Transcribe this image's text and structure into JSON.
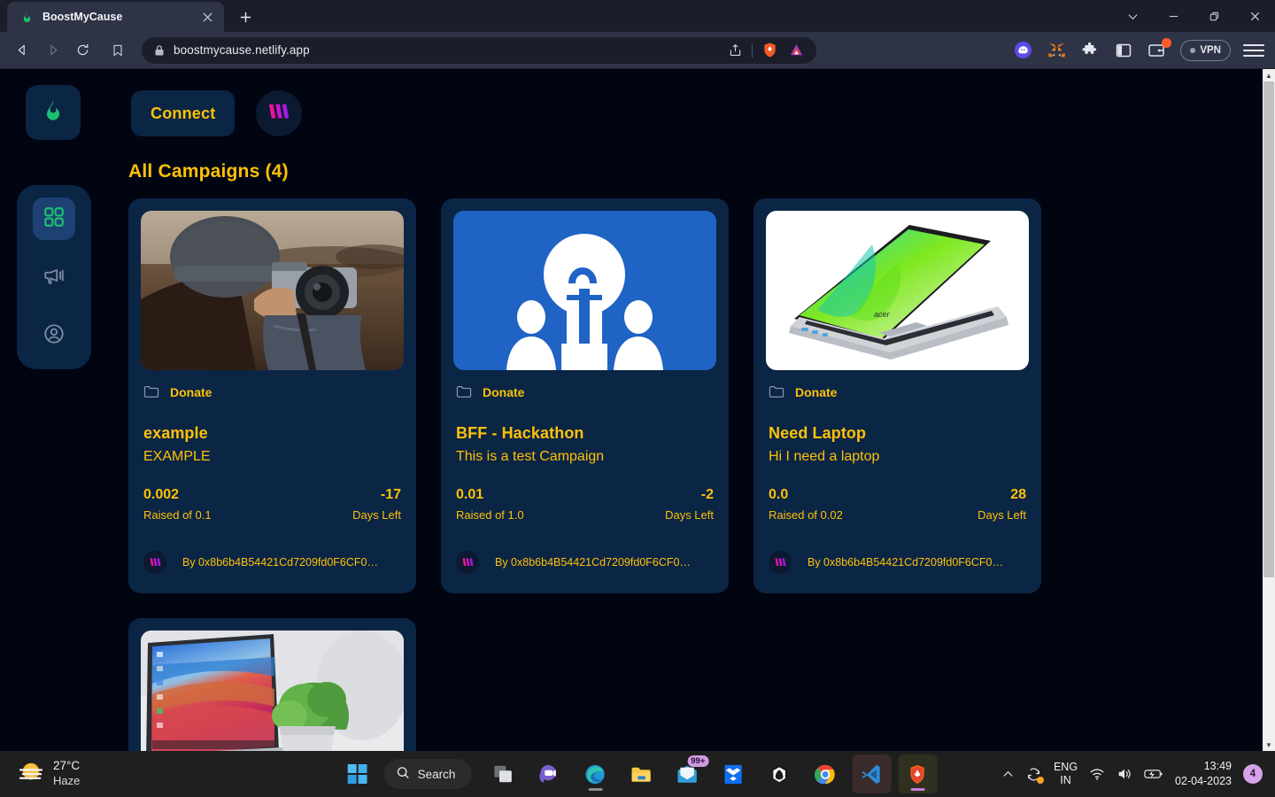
{
  "browser": {
    "tab": {
      "title": "BoostMyCause",
      "favicon_icon": "flame-favicon",
      "close_icon": "close-icon"
    },
    "new_tab_icon": "plus-icon",
    "window_controls": [
      {
        "name": "tab-search-button",
        "icon": "chevron-down-icon"
      },
      {
        "name": "minimize-button",
        "icon": "minimize-icon"
      },
      {
        "name": "restore-button",
        "icon": "restore-icon"
      },
      {
        "name": "close-window-button",
        "icon": "close-icon"
      }
    ],
    "nav": {
      "back_icon": "back-arrow-icon",
      "forward_icon": "forward-arrow-icon",
      "reload_icon": "reload-icon",
      "bookmark_icon": "bookmark-icon"
    },
    "omnibox": {
      "url": "boostmycause.netlify.app",
      "lock_icon": "lock-icon",
      "share_icon": "share-icon",
      "shields_icon": "brave-shields-icon",
      "rewards_icon": "brave-rewards-icon"
    },
    "extensions": [
      {
        "name": "phantom-wallet-icon",
        "label": "Phantom"
      },
      {
        "name": "metamask-icon",
        "label": "MetaMask"
      },
      {
        "name": "extensions-puzzle-icon",
        "label": "Extensions"
      },
      {
        "name": "sidebar-toggle-icon",
        "label": "Sidebar"
      },
      {
        "name": "brave-wallet-icon",
        "label": "Wallet"
      }
    ],
    "vpn": {
      "label": "VPN",
      "icon": "vpn-dot-icon"
    },
    "menu_icon": "hamburger-menu-icon"
  },
  "app": {
    "logo_icon": "flame-logo-icon",
    "connect_label": "Connect",
    "avatar_icon": "wallet-avatar-icon",
    "sidebar": [
      {
        "name": "sidebar-item-dashboard",
        "icon": "grid-icon",
        "active": true
      },
      {
        "name": "sidebar-item-campaign",
        "icon": "megaphone-icon",
        "active": false
      },
      {
        "name": "sidebar-item-profile",
        "icon": "profile-icon",
        "active": false
      }
    ],
    "section_title": "All Campaigns (4)",
    "cards": [
      {
        "badge": "Donate",
        "badge_icon": "folder-icon",
        "title": "example",
        "description": "EXAMPLE",
        "raised_value": "0.002",
        "raised_label": "Raised of 0.1",
        "days_value": "-17",
        "days_label": "Days Left",
        "owner": "By 0x8b6b4B54421Cd7209fd0F6CF0…",
        "image": "photographer-beanie-photo"
      },
      {
        "badge": "Donate",
        "badge_icon": "folder-icon",
        "title": "BFF - Hackathon",
        "description": "This is a test Campaign",
        "raised_value": "0.01",
        "raised_label": "Raised of 1.0",
        "days_value": "-2",
        "days_label": "Days Left",
        "owner": "By 0x8b6b4B54421Cd7209fd0F6CF0…",
        "image": "lightbulb-hackathon-logo"
      },
      {
        "badge": "Donate",
        "badge_icon": "folder-icon",
        "title": "Need Laptop",
        "description": "Hi I need a laptop",
        "raised_value": "0.0",
        "raised_label": "Raised of 0.02",
        "days_value": "28",
        "days_label": "Days Left",
        "owner": "By 0x8b6b4B54421Cd7209fd0F6CF0…",
        "image": "acer-laptop-photo"
      },
      {
        "badge": "",
        "badge_icon": "folder-icon",
        "title": "",
        "description": "",
        "raised_value": "",
        "raised_label": "",
        "days_value": "",
        "days_label": "",
        "owner": "",
        "image": "laptop-desk-plant-photo"
      }
    ]
  },
  "colors": {
    "page_bg": "#010512",
    "card_bg": "#0b2545",
    "accent_yellow": "#ffc107",
    "accent_green": "#1dc071",
    "magenta": "#e233c8",
    "sidebar_active": "#1c4172"
  },
  "taskbar": {
    "weather": {
      "temp": "27°C",
      "condition": "Haze",
      "icon": "haze-sun-icon"
    },
    "start_icon": "windows-start-icon",
    "search_label": "Search",
    "search_icon": "search-icon",
    "items": [
      {
        "name": "taskview-button",
        "icon": "task-view-icon"
      },
      {
        "name": "chat-button",
        "icon": "teams-chat-icon"
      },
      {
        "name": "edge-button",
        "icon": "edge-icon"
      },
      {
        "name": "file-explorer-button",
        "icon": "folder-icon"
      },
      {
        "name": "mail-button",
        "icon": "mail-icon",
        "badge": "99+"
      },
      {
        "name": "dropbox-button",
        "icon": "dropbox-icon"
      },
      {
        "name": "brave-nightly-button",
        "icon": "home-pentagon-icon"
      },
      {
        "name": "chrome-button",
        "icon": "chrome-icon"
      },
      {
        "name": "vscode-button",
        "icon": "vscode-icon"
      },
      {
        "name": "brave-browser-button",
        "icon": "brave-lion-icon"
      }
    ],
    "tray": {
      "overflow_icon": "chevron-up-icon",
      "sync_icon": "onedrive-sync-icon",
      "language": "ENG",
      "region": "IN",
      "wifi_icon": "wifi-icon",
      "volume_icon": "speaker-icon",
      "battery_icon": "battery-icon",
      "time": "13:49",
      "date": "02-04-2023",
      "notification_count": "4"
    }
  }
}
